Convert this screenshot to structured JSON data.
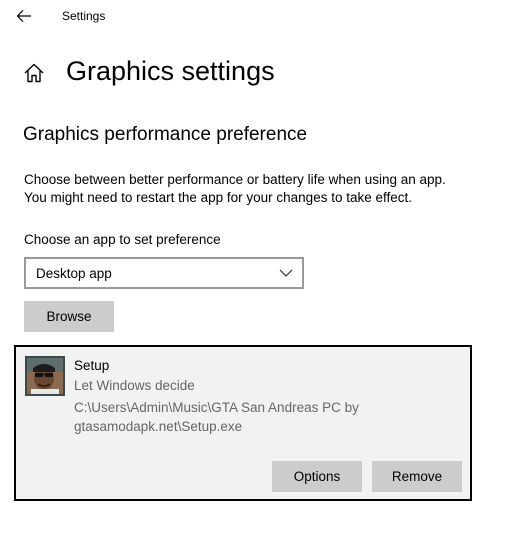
{
  "window": {
    "title": "Settings"
  },
  "icons": {
    "back": "back-arrow-icon",
    "home": "home-icon",
    "chevron": "chevron-down-icon",
    "app": "app-avatar-icon"
  },
  "page": {
    "title": "Graphics settings"
  },
  "section": {
    "title": "Graphics performance preference",
    "description_line1": "Choose between better performance or battery life when using an app.",
    "description_line2": "You might need to restart the app for your changes to take effect."
  },
  "app_type": {
    "label": "Choose an app to set preference",
    "selected": "Desktop app"
  },
  "browse": {
    "label": "Browse"
  },
  "app_card": {
    "name": "Setup",
    "preference": "Let Windows decide",
    "path_line1": "C:\\Users\\Admin\\Music\\GTA San Andreas PC by",
    "path_line2": "gtasamodapk.net\\Setup.exe",
    "options_label": "Options",
    "remove_label": "Remove"
  },
  "colors": {
    "button_bg": "#cccccc",
    "card_bg": "#f2f2f2",
    "secondary_text": "#666666"
  }
}
